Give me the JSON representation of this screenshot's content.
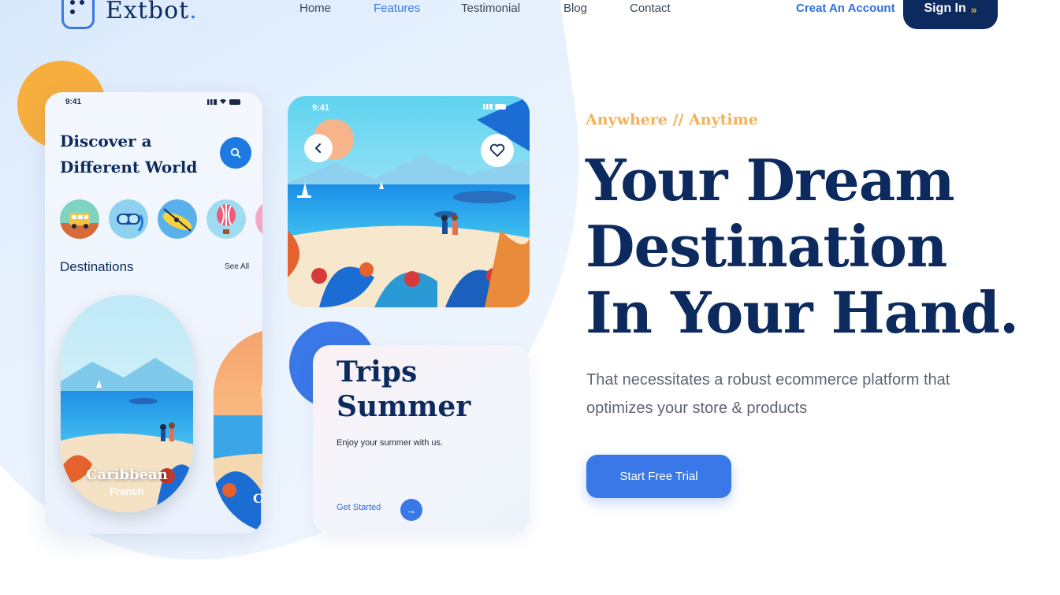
{
  "header": {
    "logo": "Extbot",
    "nav": [
      "Home",
      "Features",
      "Testimonial",
      "Blog",
      "Contact"
    ],
    "active_nav": "Features",
    "create_account": "Creat An Account",
    "sign_in": "Sign In",
    "sign_in_chevron": "»"
  },
  "phone": {
    "time": "9:41",
    "title_line1": "Discover a",
    "title_line2": "Different World",
    "section_title": "Destinations",
    "see_all": "See All",
    "card_name": "Caribbean",
    "card_sub": "French",
    "partial_card_letter": "C"
  },
  "beach_card": {
    "time": "9:41"
  },
  "trips_card": {
    "title_line1": "Trips",
    "title_line2": "Summer",
    "subtitle": "Enjoy your summer with us.",
    "cta": "Get Started"
  },
  "hero": {
    "eyebrow": "Anywhere // Anytime",
    "headline_line1": "Your Dream",
    "headline_line2": "Destination",
    "headline_line3": "In Your Hand.",
    "description": "That necessitates a robust ecommerce platform that optimizes your store & products",
    "cta": "Start Free Trial"
  },
  "colors": {
    "navy": "#0c2a5e",
    "accent_blue": "#3b78e7",
    "orange": "#f7ae3e"
  }
}
